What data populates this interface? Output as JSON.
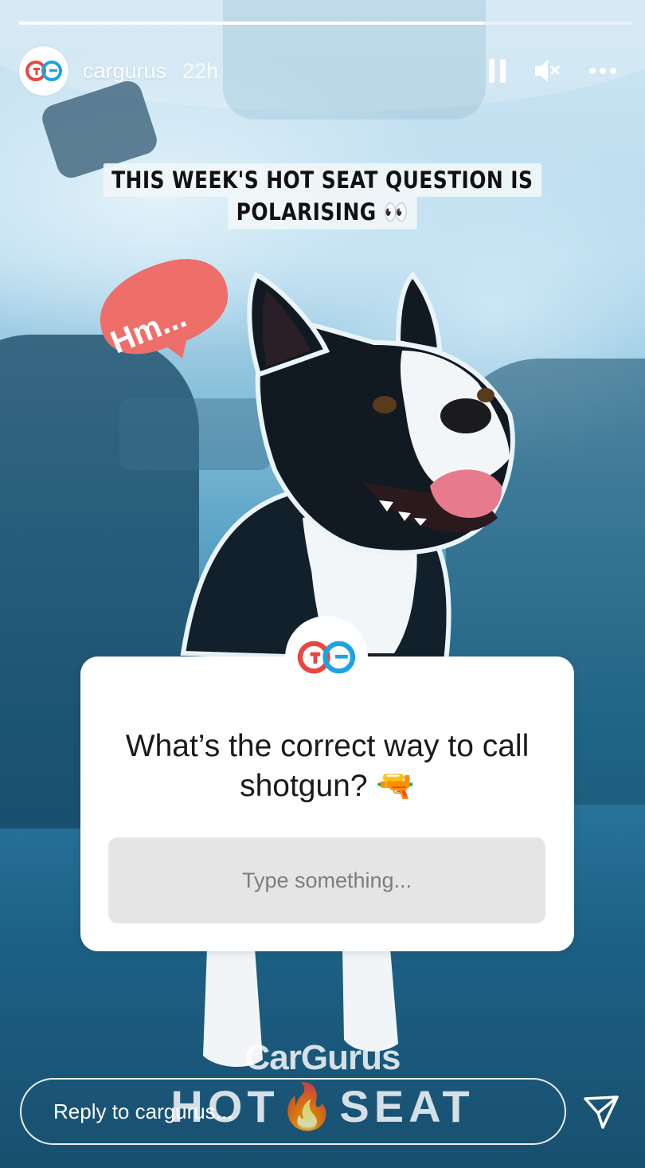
{
  "story": {
    "progress": 0.76,
    "username": "cargurus",
    "timestamp": "22h",
    "avatar_icon": "cargurus-logo-icon",
    "header_icons": [
      "pause-icon",
      "muted-speaker-icon",
      "more-options-icon"
    ]
  },
  "caption": {
    "line1": "THIS WEEK'S HOT SEAT QUESTION IS",
    "line2": "POLARISING 👀"
  },
  "sticker": {
    "text": "Hm..."
  },
  "question": {
    "text": "What’s the correct way to call shotgun? 🔫",
    "placeholder": "Type something..."
  },
  "branding": {
    "logo": "CarGurus",
    "hot": "HOT",
    "seat": "SEAT",
    "flame": "🔥"
  },
  "reply": {
    "placeholder": "Reply to cargurus...",
    "send_icon": "send-icon"
  },
  "colors": {
    "cargurus_red": "#e8473f",
    "cargurus_blue": "#1fa3e0",
    "sticker_red": "#ee6e6a",
    "overlay_blue": "#2f7ea4"
  }
}
